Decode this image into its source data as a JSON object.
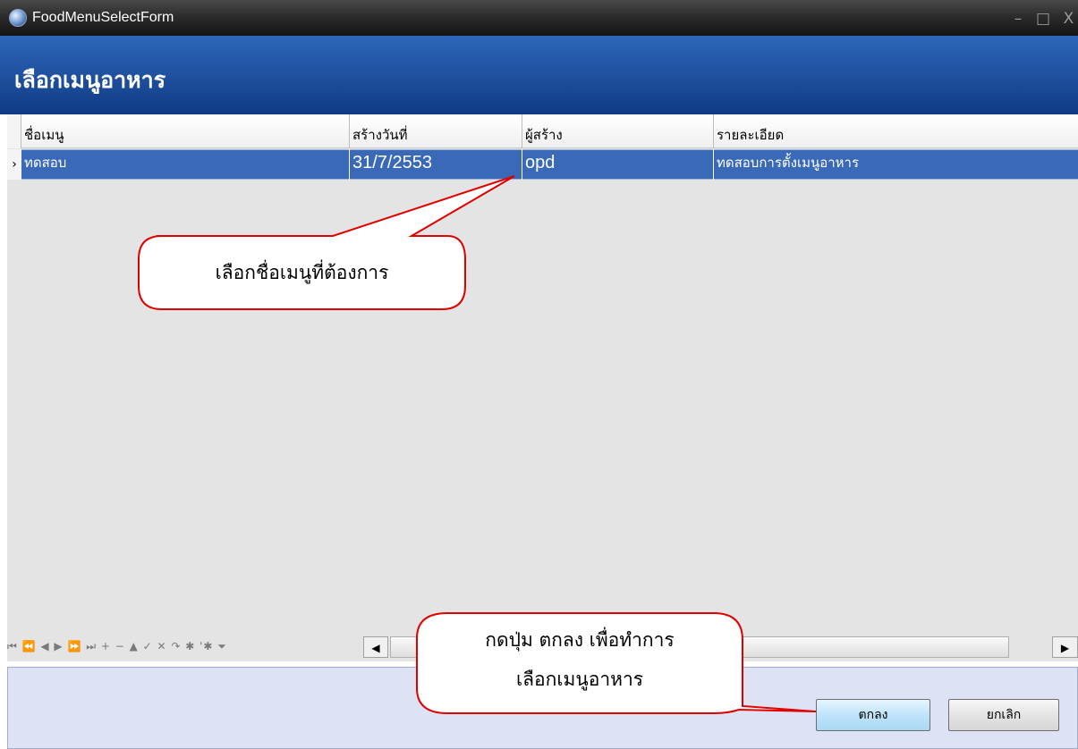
{
  "window": {
    "title": "FoodMenuSelectForm",
    "minimize_glyph": "–",
    "maximize_glyph": "□",
    "close_glyph": "X"
  },
  "header": {
    "title": "เลือกเมนูอาหาร"
  },
  "grid": {
    "columns": [
      "ชื่อเมนู",
      "สร้างวันที่",
      "ผู้สร้าง",
      "รายละเอียด"
    ],
    "rows": [
      {
        "name": "ทดสอบ",
        "created": "31/7/2553",
        "creator": "opd",
        "detail": "ทดสอบการตั้งเมนูอาหาร",
        "selected": true
      }
    ],
    "row_indicator": "›"
  },
  "navigator": {
    "glyphs": "⏮ ⏪ ◀ ▶ ⏩ ⏭ + − ▲ ✓ ✕ ↷ ✱ '✱ ⏷"
  },
  "scrollbar": {
    "left_arrow": "◀",
    "right_arrow": "▶"
  },
  "buttons": {
    "ok_label": "ตกลง",
    "cancel_label": "ยกเลิก"
  },
  "callouts": {
    "select_menu": "เลือกชื่อเมนูที่ต้องการ",
    "press_ok_line1": "กดปุ่ม ตกลง เพื่อทำการ",
    "press_ok_line2": "เลือกเมนูอาหาร"
  },
  "colors": {
    "title_bar": "#222222",
    "header_blue": "#1e4f9c",
    "selected_row": "#3a6ab7",
    "grid_background": "#e4e4e4",
    "bottom_panel": "#dde3f4",
    "callout_border": "#e00000"
  },
  "icons": {
    "app": "food-app-icon"
  }
}
